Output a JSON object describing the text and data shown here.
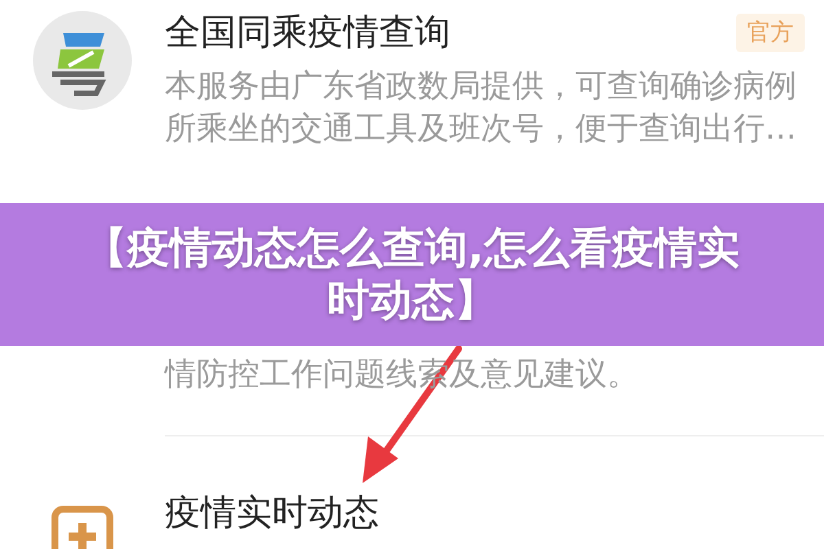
{
  "services": [
    {
      "title": "全国同乘疫情查询",
      "badge": "官方",
      "description": "本服务由广东省政数局提供，可查询确诊病例所乘坐的交通工具及班次号，便于查询出行…"
    },
    {
      "description": "情防控工作问题线索及意见建议。"
    },
    {
      "title": "疫情实时动态"
    }
  ],
  "overlay_title": "【疫情动态怎么查询,怎么看疫情实时动态】"
}
